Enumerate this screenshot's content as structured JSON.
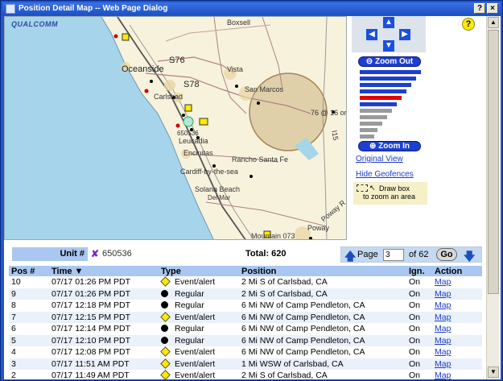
{
  "window": {
    "title": "Position Detail Map -- Web Page Dialog",
    "buttons": [
      "?",
      "×"
    ]
  },
  "map": {
    "logo": "QUALCOMM",
    "labels": [
      "Boxsell",
      "S76",
      "Vista",
      "Oceanside",
      "S78",
      "San Marcos",
      "Carlsbad",
      "76 @ 16 ord",
      "650536",
      "Leucadia",
      "Encinitas",
      "Rancho Santa Fe",
      "Cardiff-by-the-sea",
      "Solana Beach",
      "Del Mar",
      "Poway R",
      "Mountain 073",
      "Poway",
      "I5",
      "S6",
      "I15"
    ]
  },
  "controls": {
    "help_label": "?",
    "zoom_out_label": "Zoom Out",
    "zoom_in_label": "Zoom In",
    "zoom_level_index": 5,
    "zoom_levels_total": 12,
    "original_view_label": "Original View",
    "hide_geofences_label": "Hide Geofences",
    "draw_box_line1": "Draw box",
    "draw_box_line2": "to zoom an area"
  },
  "infobar": {
    "unit_label": "Unit #",
    "unit_value": "650536",
    "total": "Total: 620",
    "page_label": "Page",
    "page_value": "3",
    "of_label": "of 62",
    "go_label": "Go"
  },
  "table": {
    "headers": [
      "Pos #",
      "Time ▼",
      "Type",
      "Position",
      "Ign.",
      "Action"
    ],
    "rows": [
      {
        "pos": "10",
        "time": "07/17 01:26 PM PDT",
        "type": "Event/alert",
        "position": "2 Mi S of Carlsbad, CA",
        "ign": "On",
        "action": "Map"
      },
      {
        "pos": "9",
        "time": "07/17 01:26 PM PDT",
        "type": "Regular",
        "position": "2 Mi S of Carlsbad, CA",
        "ign": "On",
        "action": "Map"
      },
      {
        "pos": "8",
        "time": "07/17 12:18 PM PDT",
        "type": "Regular",
        "position": "6 Mi NW of Camp Pendleton, CA",
        "ign": "On",
        "action": "Map"
      },
      {
        "pos": "7",
        "time": "07/17 12:15 PM PDT",
        "type": "Event/alert",
        "position": "6 Mi NW of Camp Pendleton, CA",
        "ign": "On",
        "action": "Map"
      },
      {
        "pos": "6",
        "time": "07/17 12:14 PM PDT",
        "type": "Regular",
        "position": "6 Mi NW of Camp Pendleton, CA",
        "ign": "On",
        "action": "Map"
      },
      {
        "pos": "5",
        "time": "07/17 12:10 PM PDT",
        "type": "Regular",
        "position": "6 Mi NW of Camp Pendleton, CA",
        "ign": "On",
        "action": "Map"
      },
      {
        "pos": "4",
        "time": "07/17 12:08 PM PDT",
        "type": "Event/alert",
        "position": "6 Mi NW of Camp Pendleton, CA",
        "ign": "On",
        "action": "Map"
      },
      {
        "pos": "3",
        "time": "07/17 11:51 AM PDT",
        "type": "Event/alert",
        "position": "1 Mi WSW of Carlsbad, CA",
        "ign": "On",
        "action": "Map"
      },
      {
        "pos": "2",
        "time": "07/17 11:49 AM PDT",
        "type": "Event/alert",
        "position": "2 Mi S of Carlsbad, CA",
        "ign": "On",
        "action": "Map"
      }
    ]
  },
  "colors": {
    "titlebar": "#2456c4",
    "header_bg": "#a9c7f0",
    "link": "#1d3bc8",
    "ocean": "#a6d4ea",
    "land": "#f7f2dc",
    "geofence": "#c8a878"
  }
}
